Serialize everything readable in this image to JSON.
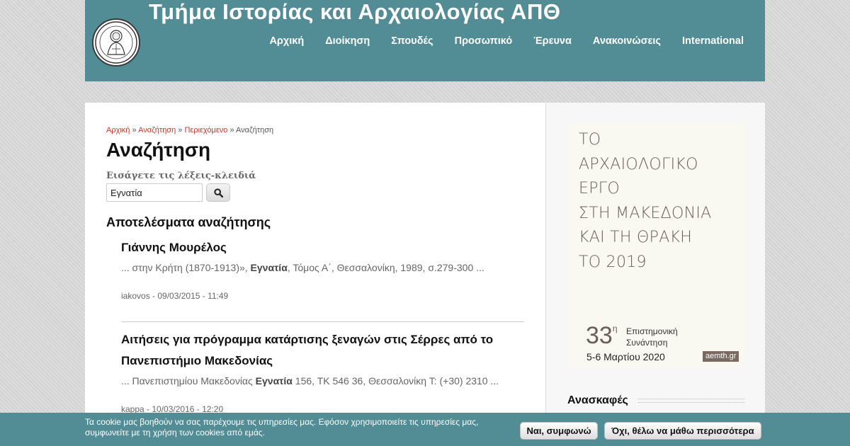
{
  "header": {
    "site_title": "Τμήμα Ιστορίας και Αρχαιολογίας ΑΠΘ",
    "nav": [
      "Αρχική",
      "Διοίκηση",
      "Σπουδές",
      "Προσωπικό",
      "Έρευνα",
      "Ανακοινώσεις",
      "International"
    ]
  },
  "breadcrumb": {
    "items": [
      "Αρχική",
      "Αναζήτηση",
      "Περιεχόμενο"
    ],
    "separator": "»",
    "current": "Αναζήτηση"
  },
  "page_title": "Αναζήτηση",
  "search": {
    "label": "Εισάγετε τις λέξεις-κλειδιά",
    "value": "Εγνατία"
  },
  "results": {
    "heading": "Αποτελέσματα αναζήτησης",
    "items": [
      {
        "title": "Γιάννης Μουρέλος",
        "snippet_before": "... στην Κρήτη (1870-1913)», ",
        "snippet_match": "Εγνατία",
        "snippet_after": ", Τόμος Α΄, Θεσσαλονίκη, 1989, σ.279-300 ...",
        "meta": "iakovos - 09/03/2015 - 11:49"
      },
      {
        "title": "Αιτήσεις για πρόγραμμα κατάρτισης ξεναγών στις Σέρρες από το Πανεπιστήμιο Μακεδονίας",
        "snippet_before": "... Πανεπιστημίου Μακεδονίας ",
        "snippet_match": "Εγνατία",
        "snippet_after": " 156, ΤΚ 546 36, Θεσσαλονίκη Τ: (+30) 2310 ...",
        "meta": "kappa - 10/03/2016 - 12:20"
      }
    ]
  },
  "sidebar": {
    "poster": {
      "lines": [
        "ΤΟ",
        "ΑΡΧΑΙΟΛΟΓΙΚΟ",
        "ΕΡΓΟ",
        "ΣΤΗ ΜΑΚΕΔΟΝΙΑ",
        "ΚΑΙ ΤΗ ΘΡΑΚΗ",
        "ΤΟ 2019"
      ],
      "number": "33",
      "superscript": "η",
      "event": "Επιστημονική Συνάντηση",
      "dates": "5-6 Μαρτίου 2020",
      "website": "aemth.gr"
    },
    "heading": "Ανασκαφές"
  },
  "cookie": {
    "text": "Τα cookie μας βοηθούν να σας παρέχουμε τις υπηρεσίες μας. Εφόσον χρησιμοποιείτε τις υπηρεσίες μας, συμφωνείτε με τη χρήση των cookies από εμάς.",
    "accept_label": "Ναι, συμφωνώ",
    "more_label": "Όχι, θέλω να μάθω περισσότερα"
  },
  "colors": {
    "header_bg": "#528c95",
    "link_red": "#c0392b",
    "poster_text": "#6b5d55"
  },
  "icons": {
    "logo": "university-seal-logo",
    "search_button": "magnifier-icon"
  }
}
